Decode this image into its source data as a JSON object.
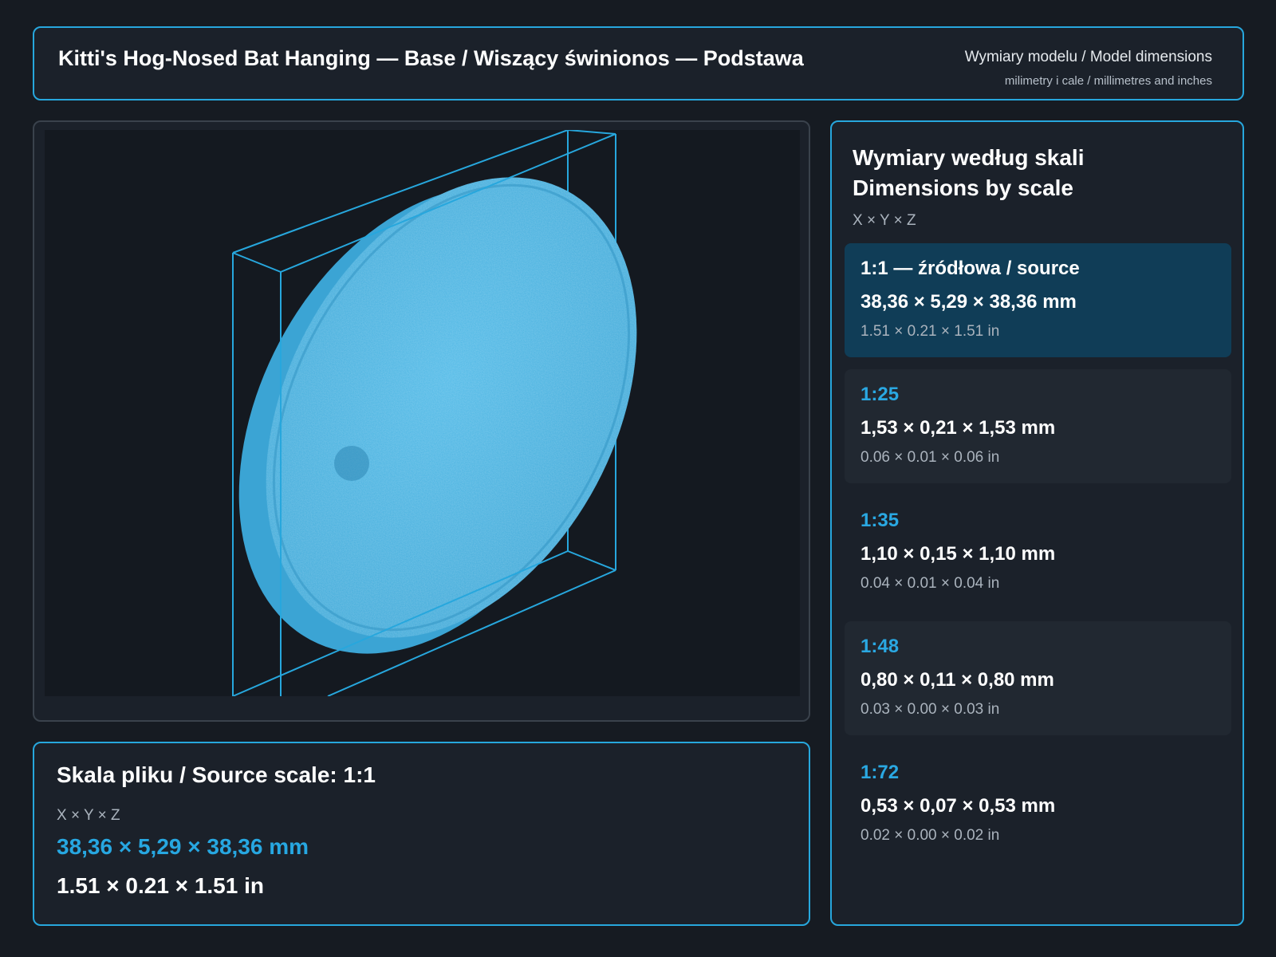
{
  "header": {
    "title": "Kitti's Hog-Nosed Bat Hanging — Base / Wiszący świnionos — Podstawa",
    "dims_title": "Wymiary modelu / Model dimensions",
    "dims_subtitle": "milimetry i cale / millimetres and inches"
  },
  "viewer": {
    "model_color": "#45b3e3",
    "bbox_color": "#27a7dd"
  },
  "source": {
    "title": "Skala pliku / Source scale: 1:1",
    "axes": "X × Y × Z",
    "mm": "38,36 × 5,29 × 38,36 mm",
    "inches": "1.51 × 0.21 × 1.51 in"
  },
  "scales": {
    "title_line1": "Wymiary według skali",
    "title_line2": "Dimensions by scale",
    "axes": "X × Y × Z",
    "rows": [
      {
        "label": "1:1  —  źródłowa / source",
        "mm": "38,36 × 5,29 × 38,36 mm",
        "inches": "1.51 × 0.21 × 1.51 in",
        "active": true
      },
      {
        "label": "1:25",
        "mm": "1,53 × 0,21 × 1,53 mm",
        "inches": "0.06 × 0.01 × 0.06 in",
        "active": false
      },
      {
        "label": "1:35",
        "mm": "1,10 × 0,15 × 1,10 mm",
        "inches": "0.04 × 0.01 × 0.04 in",
        "active": false
      },
      {
        "label": "1:48",
        "mm": "0,80 × 0,11 × 0,80 mm",
        "inches": "0.03 × 0.00 × 0.03 in",
        "active": false
      },
      {
        "label": "1:72",
        "mm": "0,53 × 0,07 × 0,53 mm",
        "inches": "0.02 × 0.00 × 0.02 in",
        "active": false
      }
    ]
  }
}
